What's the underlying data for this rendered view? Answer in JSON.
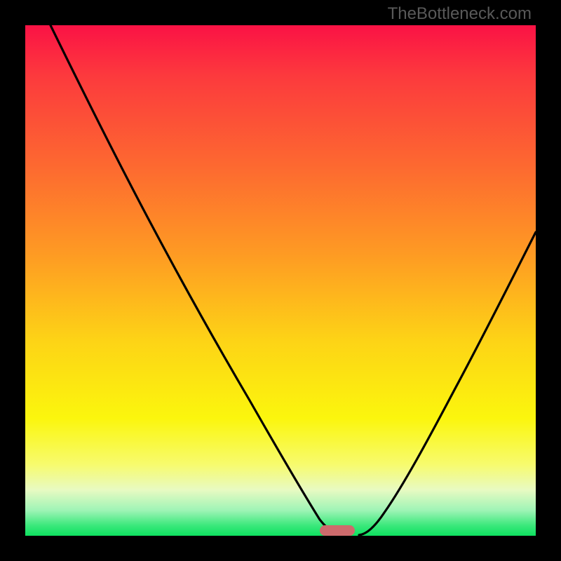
{
  "watermark": "TheBottleneck.com",
  "colors": {
    "frame": "#000000",
    "gradient_top": "#fb1245",
    "gradient_mid": "#fdd416",
    "gradient_bottom": "#0ee160",
    "curve": "#000000",
    "marker": "#cd6a6c",
    "watermark_text": "#595959"
  },
  "chart_data": {
    "type": "line",
    "title": "",
    "xlabel": "",
    "ylabel": "",
    "xlim": [
      0,
      100
    ],
    "ylim": [
      0,
      100
    ],
    "series": [
      {
        "name": "left_branch",
        "x": [
          5,
          10,
          15,
          20,
          25,
          30,
          35,
          40,
          45,
          50,
          55,
          58,
          60,
          62
        ],
        "y": [
          100,
          92,
          84,
          75,
          66,
          55,
          44,
          34,
          25,
          17,
          9,
          4,
          1,
          0
        ]
      },
      {
        "name": "right_branch",
        "x": [
          65,
          68,
          72,
          76,
          80,
          84,
          88,
          92,
          96,
          100
        ],
        "y": [
          0,
          2,
          6,
          12,
          20,
          29,
          38,
          48,
          58,
          68
        ]
      }
    ],
    "marker": {
      "x": 61,
      "y": 0,
      "shape": "rounded-bar"
    },
    "grid": false,
    "legend": false
  }
}
